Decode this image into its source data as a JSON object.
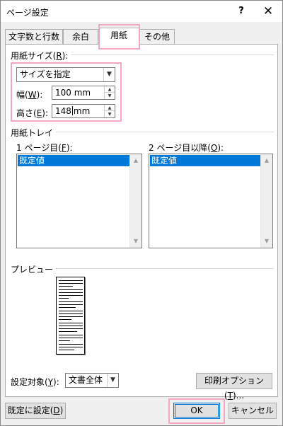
{
  "window": {
    "title": "ページ設定",
    "help_glyph": "?",
    "close_glyph": "✕"
  },
  "tabs": [
    {
      "label": "文字数と行数",
      "active": false
    },
    {
      "label": "余白",
      "active": false
    },
    {
      "label": "用紙",
      "active": true
    },
    {
      "label": "その他",
      "active": false
    }
  ],
  "paper_size": {
    "group_label_pre": "用紙サイズ(",
    "group_label_key": "R",
    "group_label_post": "):",
    "selected": "サイズを指定",
    "width_label_pre": "幅(",
    "width_label_key": "W",
    "width_label_post": "):",
    "width_value": "100 mm",
    "height_label_pre": "高さ(",
    "height_label_key": "E",
    "height_label_post": "):",
    "height_value_pre": "148",
    "height_value_post": "mm"
  },
  "paper_tray": {
    "group_label": "用紙トレイ",
    "first_page_pre": "1 ページ目(",
    "first_page_key": "F",
    "first_page_post": "):",
    "first_page_selected": "既定値",
    "other_pages_pre": "2 ページ目以降(",
    "other_pages_key": "O",
    "other_pages_post": "):",
    "other_pages_selected": "既定値"
  },
  "preview": {
    "label": "プレビュー"
  },
  "apply_to": {
    "label_pre": "設定対象(",
    "label_key": "Y",
    "label_post": "):",
    "selected": "文書全体"
  },
  "buttons": {
    "print_options_pre": "印刷オプション(",
    "print_options_key": "T",
    "print_options_post": ")...",
    "set_default_pre": "既定に設定(",
    "set_default_key": "D",
    "set_default_post": ")",
    "ok": "OK",
    "cancel": "キャンセル"
  },
  "colors": {
    "highlight": "#f4a6c5",
    "selection": "#0078d7",
    "dialog_bg": "#f0f0f0"
  }
}
